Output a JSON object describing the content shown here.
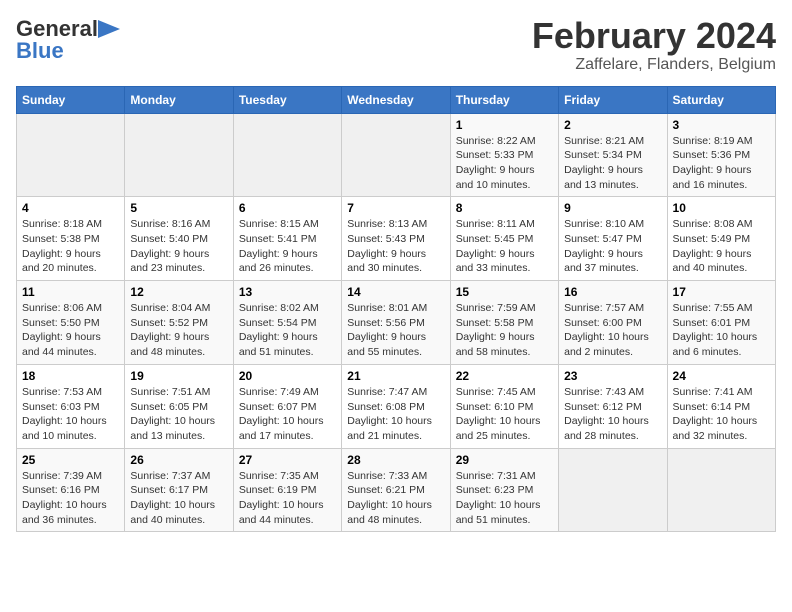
{
  "logo": {
    "line1": "General",
    "line2": "Blue"
  },
  "title": "February 2024",
  "subtitle": "Zaffelare, Flanders, Belgium",
  "days_of_week": [
    "Sunday",
    "Monday",
    "Tuesday",
    "Wednesday",
    "Thursday",
    "Friday",
    "Saturday"
  ],
  "weeks": [
    [
      {
        "day": "",
        "info": ""
      },
      {
        "day": "",
        "info": ""
      },
      {
        "day": "",
        "info": ""
      },
      {
        "day": "",
        "info": ""
      },
      {
        "day": "1",
        "info": "Sunrise: 8:22 AM\nSunset: 5:33 PM\nDaylight: 9 hours and 10 minutes."
      },
      {
        "day": "2",
        "info": "Sunrise: 8:21 AM\nSunset: 5:34 PM\nDaylight: 9 hours and 13 minutes."
      },
      {
        "day": "3",
        "info": "Sunrise: 8:19 AM\nSunset: 5:36 PM\nDaylight: 9 hours and 16 minutes."
      }
    ],
    [
      {
        "day": "4",
        "info": "Sunrise: 8:18 AM\nSunset: 5:38 PM\nDaylight: 9 hours and 20 minutes."
      },
      {
        "day": "5",
        "info": "Sunrise: 8:16 AM\nSunset: 5:40 PM\nDaylight: 9 hours and 23 minutes."
      },
      {
        "day": "6",
        "info": "Sunrise: 8:15 AM\nSunset: 5:41 PM\nDaylight: 9 hours and 26 minutes."
      },
      {
        "day": "7",
        "info": "Sunrise: 8:13 AM\nSunset: 5:43 PM\nDaylight: 9 hours and 30 minutes."
      },
      {
        "day": "8",
        "info": "Sunrise: 8:11 AM\nSunset: 5:45 PM\nDaylight: 9 hours and 33 minutes."
      },
      {
        "day": "9",
        "info": "Sunrise: 8:10 AM\nSunset: 5:47 PM\nDaylight: 9 hours and 37 minutes."
      },
      {
        "day": "10",
        "info": "Sunrise: 8:08 AM\nSunset: 5:49 PM\nDaylight: 9 hours and 40 minutes."
      }
    ],
    [
      {
        "day": "11",
        "info": "Sunrise: 8:06 AM\nSunset: 5:50 PM\nDaylight: 9 hours and 44 minutes."
      },
      {
        "day": "12",
        "info": "Sunrise: 8:04 AM\nSunset: 5:52 PM\nDaylight: 9 hours and 48 minutes."
      },
      {
        "day": "13",
        "info": "Sunrise: 8:02 AM\nSunset: 5:54 PM\nDaylight: 9 hours and 51 minutes."
      },
      {
        "day": "14",
        "info": "Sunrise: 8:01 AM\nSunset: 5:56 PM\nDaylight: 9 hours and 55 minutes."
      },
      {
        "day": "15",
        "info": "Sunrise: 7:59 AM\nSunset: 5:58 PM\nDaylight: 9 hours and 58 minutes."
      },
      {
        "day": "16",
        "info": "Sunrise: 7:57 AM\nSunset: 6:00 PM\nDaylight: 10 hours and 2 minutes."
      },
      {
        "day": "17",
        "info": "Sunrise: 7:55 AM\nSunset: 6:01 PM\nDaylight: 10 hours and 6 minutes."
      }
    ],
    [
      {
        "day": "18",
        "info": "Sunrise: 7:53 AM\nSunset: 6:03 PM\nDaylight: 10 hours and 10 minutes."
      },
      {
        "day": "19",
        "info": "Sunrise: 7:51 AM\nSunset: 6:05 PM\nDaylight: 10 hours and 13 minutes."
      },
      {
        "day": "20",
        "info": "Sunrise: 7:49 AM\nSunset: 6:07 PM\nDaylight: 10 hours and 17 minutes."
      },
      {
        "day": "21",
        "info": "Sunrise: 7:47 AM\nSunset: 6:08 PM\nDaylight: 10 hours and 21 minutes."
      },
      {
        "day": "22",
        "info": "Sunrise: 7:45 AM\nSunset: 6:10 PM\nDaylight: 10 hours and 25 minutes."
      },
      {
        "day": "23",
        "info": "Sunrise: 7:43 AM\nSunset: 6:12 PM\nDaylight: 10 hours and 28 minutes."
      },
      {
        "day": "24",
        "info": "Sunrise: 7:41 AM\nSunset: 6:14 PM\nDaylight: 10 hours and 32 minutes."
      }
    ],
    [
      {
        "day": "25",
        "info": "Sunrise: 7:39 AM\nSunset: 6:16 PM\nDaylight: 10 hours and 36 minutes."
      },
      {
        "day": "26",
        "info": "Sunrise: 7:37 AM\nSunset: 6:17 PM\nDaylight: 10 hours and 40 minutes."
      },
      {
        "day": "27",
        "info": "Sunrise: 7:35 AM\nSunset: 6:19 PM\nDaylight: 10 hours and 44 minutes."
      },
      {
        "day": "28",
        "info": "Sunrise: 7:33 AM\nSunset: 6:21 PM\nDaylight: 10 hours and 48 minutes."
      },
      {
        "day": "29",
        "info": "Sunrise: 7:31 AM\nSunset: 6:23 PM\nDaylight: 10 hours and 51 minutes."
      },
      {
        "day": "",
        "info": ""
      },
      {
        "day": "",
        "info": ""
      }
    ]
  ]
}
